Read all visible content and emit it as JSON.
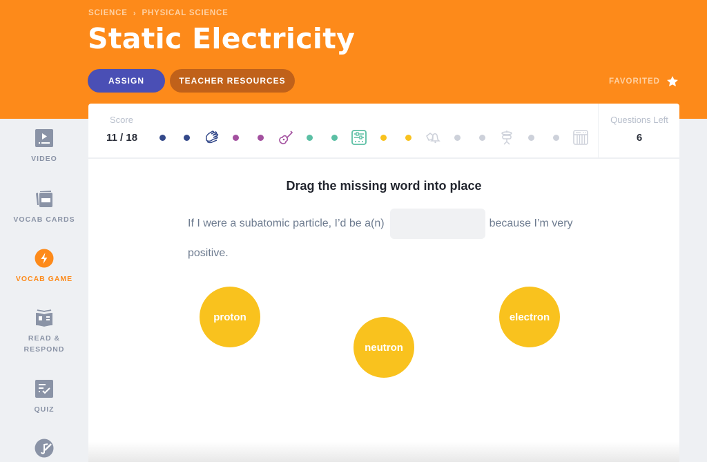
{
  "header": {
    "breadcrumb": [
      "SCIENCE",
      "PHYSICAL SCIENCE"
    ],
    "breadcrumb_separator": "›",
    "title": "Static Electricity",
    "assign_label": "ASSIGN",
    "teacher_resources_label": "TEACHER RESOURCES",
    "favorited_label": "FAVORITED",
    "favorite_icon": "star-icon"
  },
  "colors": {
    "brand_orange": "#fd8a1a",
    "assign_blue": "#4a4fb5",
    "teacher_brown": "#c0611a",
    "word_yellow": "#f9c21e"
  },
  "sidebar": {
    "items": [
      {
        "label": "VIDEO",
        "icon": "video-icon",
        "active": false
      },
      {
        "label": "VOCAB CARDS",
        "icon": "vocab-cards-icon",
        "active": false
      },
      {
        "label": "VOCAB GAME",
        "icon": "lightning-icon",
        "active": true
      },
      {
        "label": "READ & RESPOND",
        "icon": "book-icon",
        "active": false
      },
      {
        "label": "QUIZ",
        "icon": "quiz-icon",
        "active": false
      },
      {
        "label": "",
        "icon": "music-note-icon",
        "active": false
      }
    ]
  },
  "score": {
    "label": "Score",
    "value": "11 / 18",
    "questions_left_label": "Questions Left",
    "questions_left_value": "6",
    "progress": [
      {
        "type": "dot",
        "color": "#34498a"
      },
      {
        "type": "dot",
        "color": "#34498a"
      },
      {
        "type": "icon",
        "icon": "clapping-hands-icon",
        "color": "#34498a"
      },
      {
        "type": "dot",
        "color": "#a3509f"
      },
      {
        "type": "dot",
        "color": "#a3509f"
      },
      {
        "type": "icon",
        "icon": "guitar-icon",
        "color": "#a3509f"
      },
      {
        "type": "dot",
        "color": "#5bbfa4"
      },
      {
        "type": "dot",
        "color": "#5bbfa4"
      },
      {
        "type": "icon",
        "icon": "mixer-icon",
        "color": "#5bbfa4"
      },
      {
        "type": "dot",
        "color": "#f9c21e"
      },
      {
        "type": "dot",
        "color": "#f9c21e"
      },
      {
        "type": "icon",
        "icon": "bells-icon",
        "color": "#cdd1da"
      },
      {
        "type": "dot",
        "color": "#cdd1da"
      },
      {
        "type": "dot",
        "color": "#cdd1da"
      },
      {
        "type": "icon",
        "icon": "drum-icon",
        "color": "#cdd1da"
      },
      {
        "type": "dot",
        "color": "#cdd1da"
      },
      {
        "type": "dot",
        "color": "#cdd1da"
      },
      {
        "type": "icon",
        "icon": "keyboard-icon",
        "color": "#cdd1da"
      }
    ]
  },
  "game": {
    "instruction": "Drag the missing word into place",
    "sentence_before": "If I were a subatomic particle, I’d be a(n)",
    "sentence_after": "because I’m very positive.",
    "words": [
      "proton",
      "neutron",
      "electron"
    ]
  }
}
